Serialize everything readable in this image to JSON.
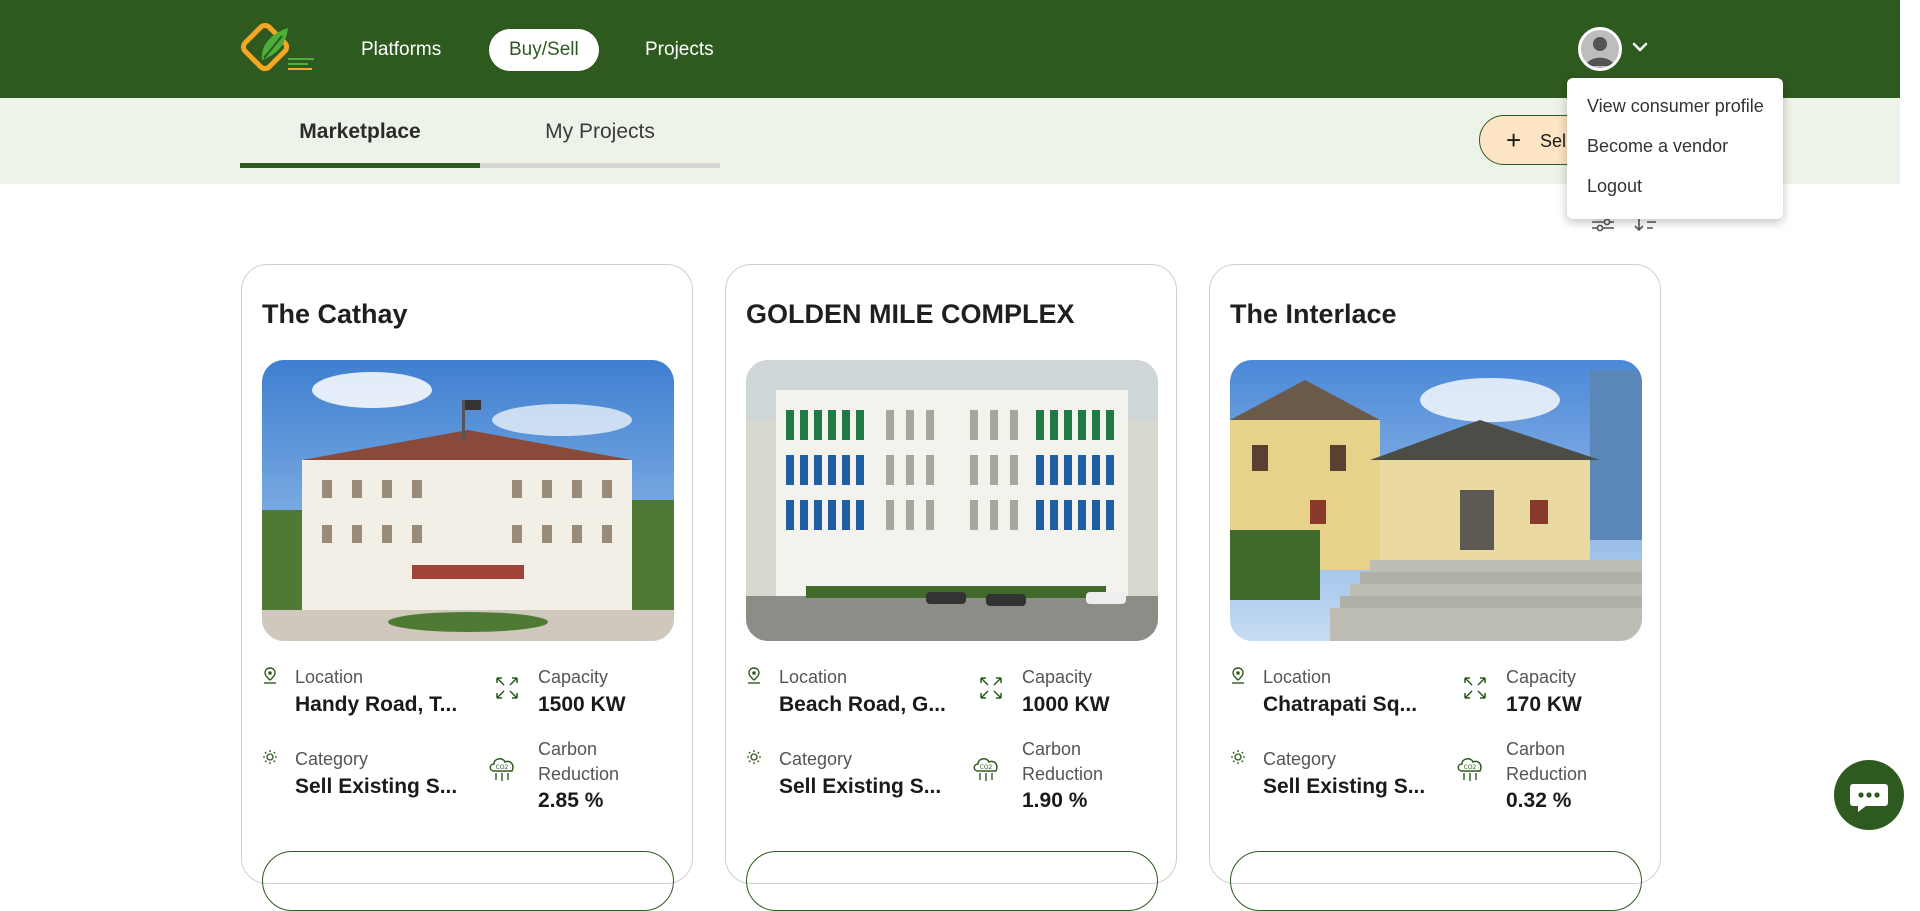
{
  "nav": {
    "links": [
      {
        "label": "Platforms"
      },
      {
        "label": "Buy/Sell"
      },
      {
        "label": "Projects"
      }
    ]
  },
  "tabs": [
    {
      "label": "Marketplace"
    },
    {
      "label": "My Projects"
    }
  ],
  "sell_button": {
    "label": "Sel"
  },
  "dropdown": {
    "items": [
      "View consumer profile",
      "Become a vendor",
      "Logout"
    ]
  },
  "cards": [
    {
      "title": "The Cathay",
      "location_label": "Location",
      "location_value": "Handy Road, T...",
      "capacity_label": "Capacity",
      "capacity_value": "1500 KW",
      "category_label": "Category",
      "category_value": "Sell Existing S...",
      "carbon_label_1": "Carbon",
      "carbon_label_2": "Reduction",
      "carbon_value": "2.85 %"
    },
    {
      "title": "GOLDEN MILE COMPLEX",
      "location_label": "Location",
      "location_value": "Beach Road, G...",
      "capacity_label": "Capacity",
      "capacity_value": "1000 KW",
      "category_label": "Category",
      "category_value": "Sell Existing S...",
      "carbon_label_1": "Carbon",
      "carbon_label_2": "Reduction",
      "carbon_value": "1.90 %"
    },
    {
      "title": "The Interlace",
      "location_label": "Location",
      "location_value": "Chatrapati Sq...",
      "capacity_label": "Capacity",
      "capacity_value": "170 KW",
      "category_label": "Category",
      "category_value": "Sell Existing S...",
      "carbon_label_1": "Carbon",
      "carbon_label_2": "Reduction",
      "carbon_value": "0.32 %"
    }
  ],
  "colors": {
    "brand_green": "#2f5a1f",
    "subbar_bg": "#eef3ea",
    "sell_button_bg": "#fde4c5",
    "logo_orange": "#f5a623"
  },
  "icons": [
    "logo-icon",
    "avatar-icon",
    "chevron-down-icon",
    "plus-icon",
    "filter-icon",
    "sort-icon",
    "location-pin-icon",
    "capacity-expand-icon",
    "category-sun-icon",
    "co2-cloud-icon",
    "chat-icon"
  ]
}
